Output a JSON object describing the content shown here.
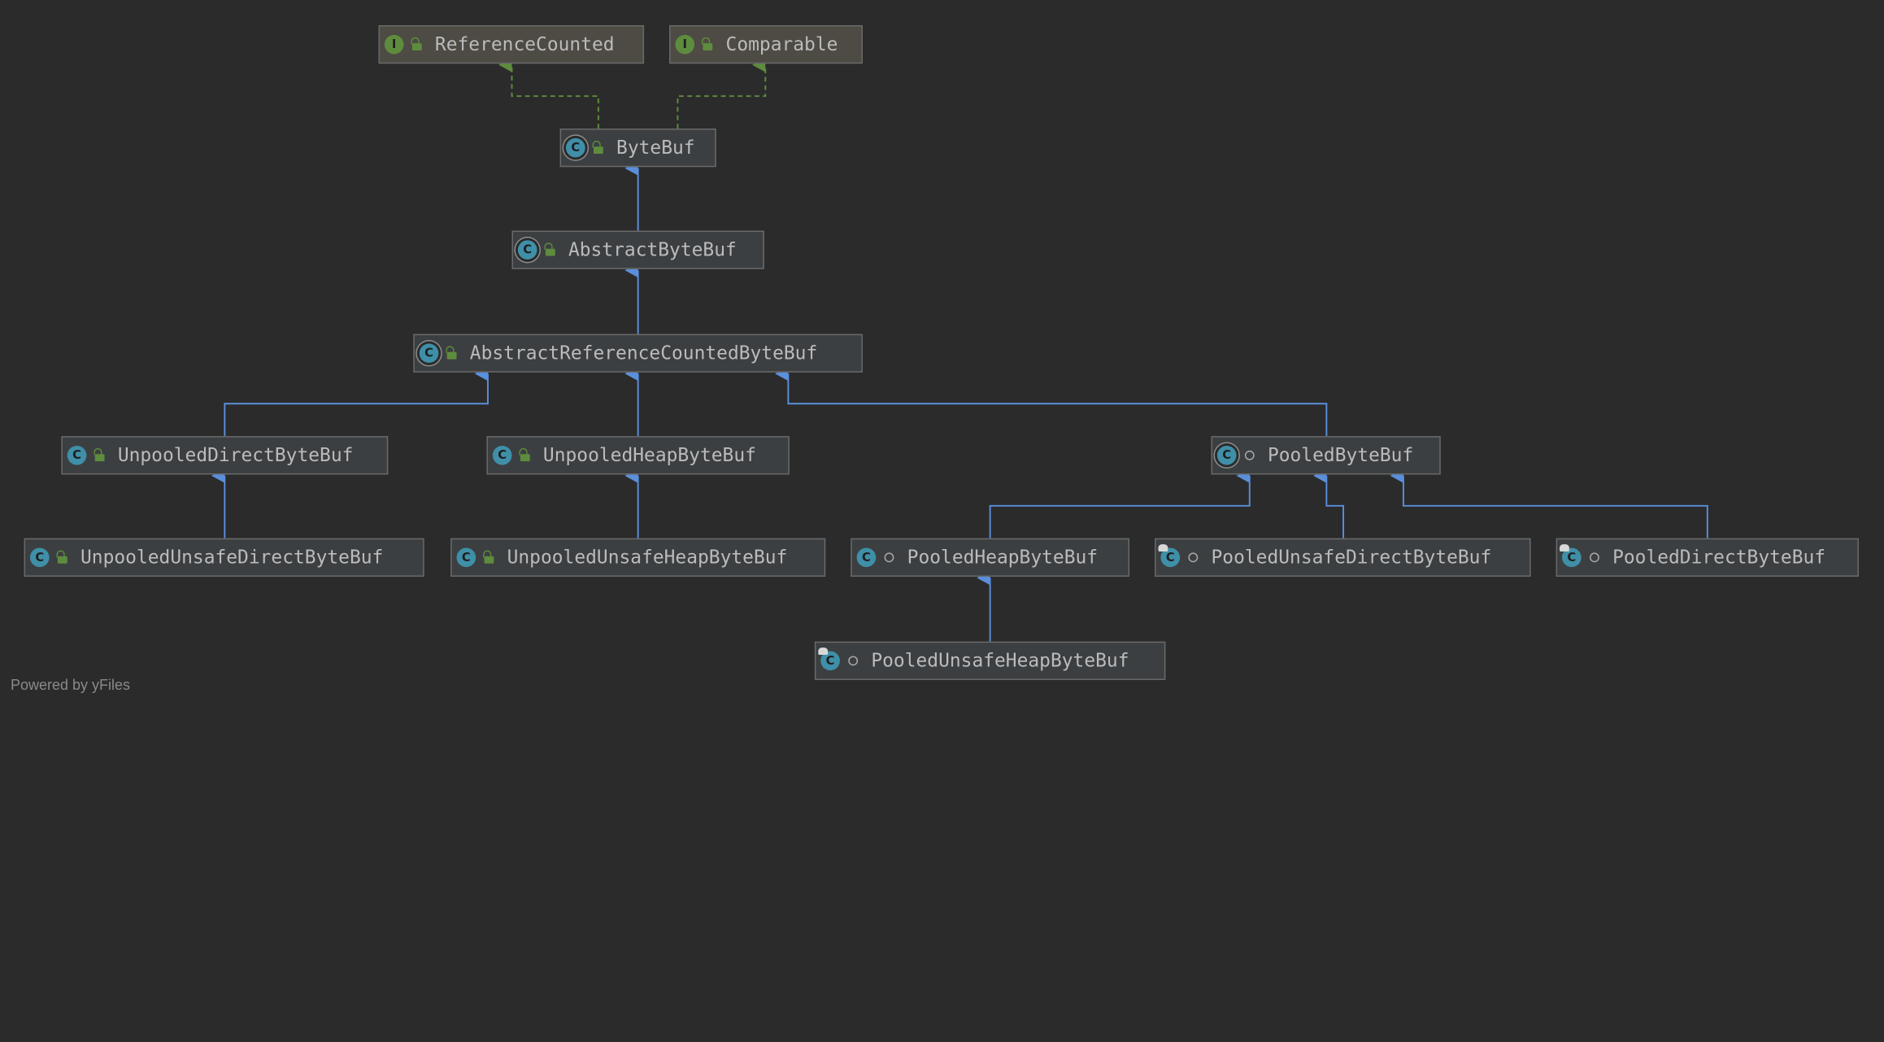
{
  "diagram": {
    "type": "uml-class-hierarchy",
    "colors": {
      "background": "#2b2b2b",
      "node_background": "#3c3f41",
      "interface_node_background": "#4d4b43",
      "node_border": "#6a6a6a",
      "text": "#bbbbbb",
      "extends_edge": "#5a8fdc",
      "implements_edge": "#5e8c3e",
      "class_icon": "#3f8fa8",
      "interface_icon": "#5e8c3e"
    },
    "nodes": [
      {
        "id": "ReferenceCounted",
        "label": "ReferenceCounted",
        "kind": "interface",
        "kind_icon": "interface-icon",
        "kind_letter": "I",
        "visibility": "public"
      },
      {
        "id": "Comparable",
        "label": "Comparable",
        "kind": "interface",
        "kind_icon": "interface-icon",
        "kind_letter": "I",
        "visibility": "public"
      },
      {
        "id": "ByteBuf",
        "label": "ByteBuf",
        "kind": "abstract-class",
        "kind_icon": "abstract-class-icon",
        "kind_letter": "C",
        "visibility": "public"
      },
      {
        "id": "AbstractByteBuf",
        "label": "AbstractByteBuf",
        "kind": "abstract-class",
        "kind_icon": "abstract-class-icon",
        "kind_letter": "C",
        "visibility": "public"
      },
      {
        "id": "AbstractReferenceCountedByteBuf",
        "label": "AbstractReferenceCountedByteBuf",
        "kind": "abstract-class",
        "kind_icon": "abstract-class-icon",
        "kind_letter": "C",
        "visibility": "public"
      },
      {
        "id": "UnpooledDirectByteBuf",
        "label": "UnpooledDirectByteBuf",
        "kind": "class",
        "kind_icon": "class-icon",
        "kind_letter": "C",
        "visibility": "public"
      },
      {
        "id": "UnpooledHeapByteBuf",
        "label": "UnpooledHeapByteBuf",
        "kind": "class",
        "kind_icon": "class-icon",
        "kind_letter": "C",
        "visibility": "public"
      },
      {
        "id": "PooledByteBuf",
        "label": "PooledByteBuf",
        "kind": "abstract-class",
        "kind_icon": "abstract-class-icon",
        "kind_letter": "C",
        "visibility": "package"
      },
      {
        "id": "UnpooledUnsafeDirectByteBuf",
        "label": "UnpooledUnsafeDirectByteBuf",
        "kind": "class",
        "kind_icon": "class-icon",
        "kind_letter": "C",
        "visibility": "public"
      },
      {
        "id": "UnpooledUnsafeHeapByteBuf",
        "label": "UnpooledUnsafeHeapByteBuf",
        "kind": "class",
        "kind_icon": "class-icon",
        "kind_letter": "C",
        "visibility": "public"
      },
      {
        "id": "PooledHeapByteBuf",
        "label": "PooledHeapByteBuf",
        "kind": "class",
        "kind_icon": "class-icon",
        "kind_letter": "C",
        "visibility": "package"
      },
      {
        "id": "PooledUnsafeDirectByteBuf",
        "label": "PooledUnsafeDirectByteBuf",
        "kind": "final-class",
        "kind_icon": "final-class-icon",
        "kind_letter": "C",
        "visibility": "package"
      },
      {
        "id": "PooledDirectByteBuf",
        "label": "PooledDirectByteBuf",
        "kind": "final-class",
        "kind_icon": "final-class-icon",
        "kind_letter": "C",
        "visibility": "package"
      },
      {
        "id": "PooledUnsafeHeapByteBuf",
        "label": "PooledUnsafeHeapByteBuf",
        "kind": "final-class",
        "kind_icon": "final-class-icon",
        "kind_letter": "C",
        "visibility": "package"
      }
    ],
    "edges": [
      {
        "from": "ByteBuf",
        "to": "ReferenceCounted",
        "type": "implements"
      },
      {
        "from": "ByteBuf",
        "to": "Comparable",
        "type": "implements"
      },
      {
        "from": "AbstractByteBuf",
        "to": "ByteBuf",
        "type": "extends"
      },
      {
        "from": "AbstractReferenceCountedByteBuf",
        "to": "AbstractByteBuf",
        "type": "extends"
      },
      {
        "from": "UnpooledDirectByteBuf",
        "to": "AbstractReferenceCountedByteBuf",
        "type": "extends"
      },
      {
        "from": "UnpooledHeapByteBuf",
        "to": "AbstractReferenceCountedByteBuf",
        "type": "extends"
      },
      {
        "from": "PooledByteBuf",
        "to": "AbstractReferenceCountedByteBuf",
        "type": "extends"
      },
      {
        "from": "UnpooledUnsafeDirectByteBuf",
        "to": "UnpooledDirectByteBuf",
        "type": "extends"
      },
      {
        "from": "UnpooledUnsafeHeapByteBuf",
        "to": "UnpooledHeapByteBuf",
        "type": "extends"
      },
      {
        "from": "PooledHeapByteBuf",
        "to": "PooledByteBuf",
        "type": "extends"
      },
      {
        "from": "PooledUnsafeDirectByteBuf",
        "to": "PooledByteBuf",
        "type": "extends"
      },
      {
        "from": "PooledDirectByteBuf",
        "to": "PooledByteBuf",
        "type": "extends"
      },
      {
        "from": "PooledUnsafeHeapByteBuf",
        "to": "PooledHeapByteBuf",
        "type": "extends"
      }
    ]
  },
  "footer": {
    "powered_by": "Powered by yFiles"
  }
}
